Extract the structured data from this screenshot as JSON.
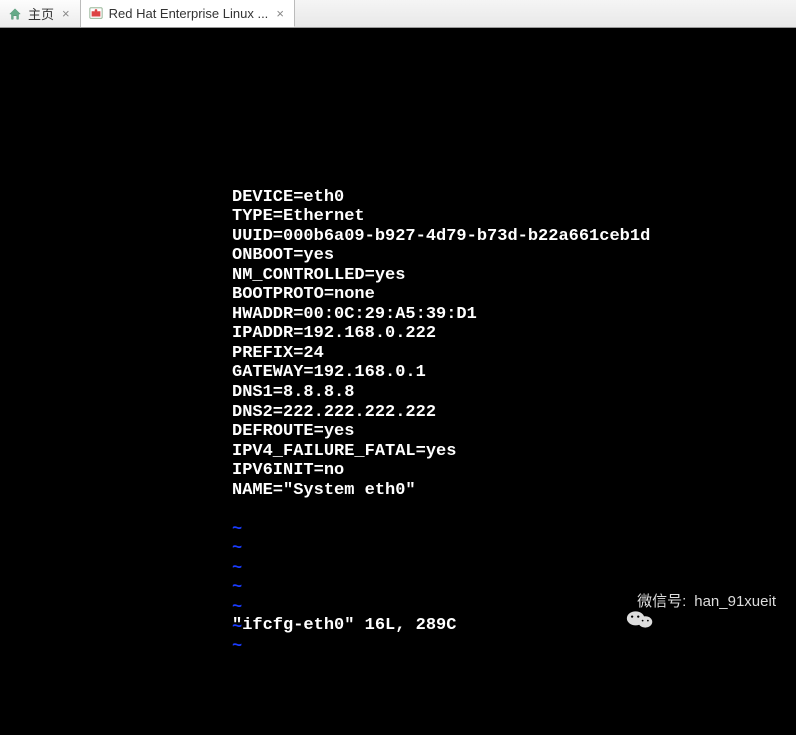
{
  "tabs": {
    "home": {
      "label": "主页"
    },
    "vm": {
      "label": "Red Hat Enterprise Linux ..."
    }
  },
  "config": {
    "lines": [
      "DEVICE=eth0",
      "TYPE=Ethernet",
      "UUID=000b6a09-b927-4d79-b73d-b22a661ceb1d",
      "ONBOOT=yes",
      "NM_CONTROLLED=yes",
      "BOOTPROTO=none",
      "HWADDR=00:0C:29:A5:39:D1",
      "IPADDR=192.168.0.222",
      "PREFIX=24",
      "GATEWAY=192.168.0.1",
      "DNS1=8.8.8.8",
      "DNS2=222.222.222.222",
      "DEFROUTE=yes",
      "IPV4_FAILURE_FATAL=yes",
      "IPV6INIT=no",
      "NAME=\"System eth0\""
    ],
    "tilde_count": 7,
    "tilde_char": "~",
    "status": "\"ifcfg-eth0\" 16L, 289C"
  },
  "watermark": {
    "label_prefix": "微信号:",
    "handle": "han_91xueit"
  }
}
